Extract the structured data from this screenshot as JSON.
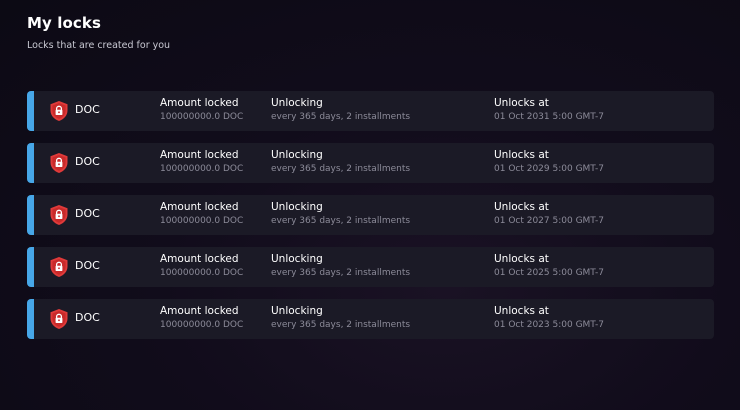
{
  "header": {
    "title": "My locks",
    "subtitle": "Locks that are created for you"
  },
  "colors": {
    "accent": "#47a7e8",
    "row_background": "#1b1a26",
    "lock_icon": "#e03a3a"
  },
  "columns": {
    "amount_heading": "Amount locked",
    "unlocking_heading": "Unlocking",
    "unlocks_at_heading": "Unlocks at"
  },
  "locks": [
    {
      "icon": "lock-shield-icon",
      "token": "DOC",
      "amount": "100000000.0 DOC",
      "unlocking": "every 365 days, 2 installments",
      "unlocks_at": "01 Oct 2031 5:00 GMT-7"
    },
    {
      "icon": "lock-shield-icon",
      "token": "DOC",
      "amount": "100000000.0 DOC",
      "unlocking": "every 365 days, 2 installments",
      "unlocks_at": "01 Oct 2029 5:00 GMT-7"
    },
    {
      "icon": "lock-shield-icon",
      "token": "DOC",
      "amount": "100000000.0 DOC",
      "unlocking": "every 365 days, 2 installments",
      "unlocks_at": "01 Oct 2027 5:00 GMT-7"
    },
    {
      "icon": "lock-shield-icon",
      "token": "DOC",
      "amount": "100000000.0 DOC",
      "unlocking": "every 365 days, 2 installments",
      "unlocks_at": "01 Oct 2025 5:00 GMT-7"
    },
    {
      "icon": "lock-shield-icon",
      "token": "DOC",
      "amount": "100000000.0 DOC",
      "unlocking": "every 365 days, 2 installments",
      "unlocks_at": "01 Oct 2023 5:00 GMT-7"
    }
  ]
}
